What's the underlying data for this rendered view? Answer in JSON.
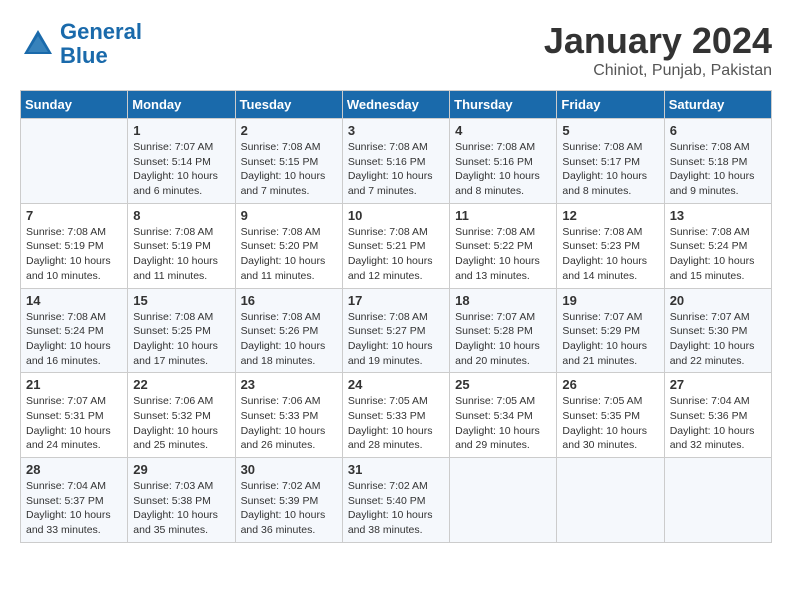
{
  "header": {
    "logo_line1": "General",
    "logo_line2": "Blue",
    "month": "January 2024",
    "location": "Chiniot, Punjab, Pakistan"
  },
  "columns": [
    "Sunday",
    "Monday",
    "Tuesday",
    "Wednesday",
    "Thursday",
    "Friday",
    "Saturday"
  ],
  "weeks": [
    [
      {
        "num": "",
        "info": ""
      },
      {
        "num": "1",
        "info": "Sunrise: 7:07 AM\nSunset: 5:14 PM\nDaylight: 10 hours\nand 6 minutes."
      },
      {
        "num": "2",
        "info": "Sunrise: 7:08 AM\nSunset: 5:15 PM\nDaylight: 10 hours\nand 7 minutes."
      },
      {
        "num": "3",
        "info": "Sunrise: 7:08 AM\nSunset: 5:16 PM\nDaylight: 10 hours\nand 7 minutes."
      },
      {
        "num": "4",
        "info": "Sunrise: 7:08 AM\nSunset: 5:16 PM\nDaylight: 10 hours\nand 8 minutes."
      },
      {
        "num": "5",
        "info": "Sunrise: 7:08 AM\nSunset: 5:17 PM\nDaylight: 10 hours\nand 8 minutes."
      },
      {
        "num": "6",
        "info": "Sunrise: 7:08 AM\nSunset: 5:18 PM\nDaylight: 10 hours\nand 9 minutes."
      }
    ],
    [
      {
        "num": "7",
        "info": "Sunrise: 7:08 AM\nSunset: 5:19 PM\nDaylight: 10 hours\nand 10 minutes."
      },
      {
        "num": "8",
        "info": "Sunrise: 7:08 AM\nSunset: 5:19 PM\nDaylight: 10 hours\nand 11 minutes."
      },
      {
        "num": "9",
        "info": "Sunrise: 7:08 AM\nSunset: 5:20 PM\nDaylight: 10 hours\nand 11 minutes."
      },
      {
        "num": "10",
        "info": "Sunrise: 7:08 AM\nSunset: 5:21 PM\nDaylight: 10 hours\nand 12 minutes."
      },
      {
        "num": "11",
        "info": "Sunrise: 7:08 AM\nSunset: 5:22 PM\nDaylight: 10 hours\nand 13 minutes."
      },
      {
        "num": "12",
        "info": "Sunrise: 7:08 AM\nSunset: 5:23 PM\nDaylight: 10 hours\nand 14 minutes."
      },
      {
        "num": "13",
        "info": "Sunrise: 7:08 AM\nSunset: 5:24 PM\nDaylight: 10 hours\nand 15 minutes."
      }
    ],
    [
      {
        "num": "14",
        "info": "Sunrise: 7:08 AM\nSunset: 5:24 PM\nDaylight: 10 hours\nand 16 minutes."
      },
      {
        "num": "15",
        "info": "Sunrise: 7:08 AM\nSunset: 5:25 PM\nDaylight: 10 hours\nand 17 minutes."
      },
      {
        "num": "16",
        "info": "Sunrise: 7:08 AM\nSunset: 5:26 PM\nDaylight: 10 hours\nand 18 minutes."
      },
      {
        "num": "17",
        "info": "Sunrise: 7:08 AM\nSunset: 5:27 PM\nDaylight: 10 hours\nand 19 minutes."
      },
      {
        "num": "18",
        "info": "Sunrise: 7:07 AM\nSunset: 5:28 PM\nDaylight: 10 hours\nand 20 minutes."
      },
      {
        "num": "19",
        "info": "Sunrise: 7:07 AM\nSunset: 5:29 PM\nDaylight: 10 hours\nand 21 minutes."
      },
      {
        "num": "20",
        "info": "Sunrise: 7:07 AM\nSunset: 5:30 PM\nDaylight: 10 hours\nand 22 minutes."
      }
    ],
    [
      {
        "num": "21",
        "info": "Sunrise: 7:07 AM\nSunset: 5:31 PM\nDaylight: 10 hours\nand 24 minutes."
      },
      {
        "num": "22",
        "info": "Sunrise: 7:06 AM\nSunset: 5:32 PM\nDaylight: 10 hours\nand 25 minutes."
      },
      {
        "num": "23",
        "info": "Sunrise: 7:06 AM\nSunset: 5:33 PM\nDaylight: 10 hours\nand 26 minutes."
      },
      {
        "num": "24",
        "info": "Sunrise: 7:05 AM\nSunset: 5:33 PM\nDaylight: 10 hours\nand 28 minutes."
      },
      {
        "num": "25",
        "info": "Sunrise: 7:05 AM\nSunset: 5:34 PM\nDaylight: 10 hours\nand 29 minutes."
      },
      {
        "num": "26",
        "info": "Sunrise: 7:05 AM\nSunset: 5:35 PM\nDaylight: 10 hours\nand 30 minutes."
      },
      {
        "num": "27",
        "info": "Sunrise: 7:04 AM\nSunset: 5:36 PM\nDaylight: 10 hours\nand 32 minutes."
      }
    ],
    [
      {
        "num": "28",
        "info": "Sunrise: 7:04 AM\nSunset: 5:37 PM\nDaylight: 10 hours\nand 33 minutes."
      },
      {
        "num": "29",
        "info": "Sunrise: 7:03 AM\nSunset: 5:38 PM\nDaylight: 10 hours\nand 35 minutes."
      },
      {
        "num": "30",
        "info": "Sunrise: 7:02 AM\nSunset: 5:39 PM\nDaylight: 10 hours\nand 36 minutes."
      },
      {
        "num": "31",
        "info": "Sunrise: 7:02 AM\nSunset: 5:40 PM\nDaylight: 10 hours\nand 38 minutes."
      },
      {
        "num": "",
        "info": ""
      },
      {
        "num": "",
        "info": ""
      },
      {
        "num": "",
        "info": ""
      }
    ]
  ]
}
